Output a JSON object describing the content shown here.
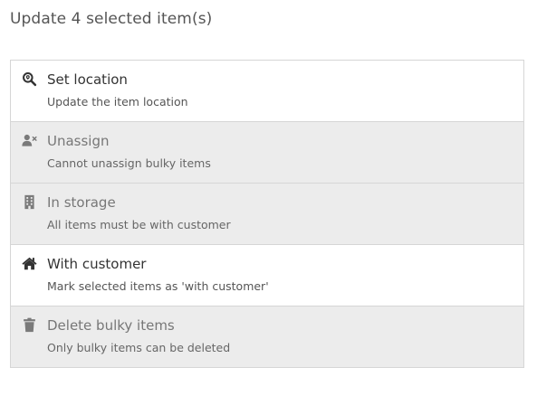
{
  "dialog": {
    "title": "Update 4 selected item(s)"
  },
  "options": [
    {
      "icon": "search-location-icon",
      "label": "Set location",
      "description": "Update the item location",
      "enabled": true
    },
    {
      "icon": "user-remove-icon",
      "label": "Unassign",
      "description": "Cannot unassign bulky items",
      "enabled": false
    },
    {
      "icon": "building-icon",
      "label": "In storage",
      "description": "All items must be with customer",
      "enabled": false
    },
    {
      "icon": "home-icon",
      "label": "With customer",
      "description": "Mark selected items as 'with customer'",
      "enabled": true
    },
    {
      "icon": "trash-icon",
      "label": "Delete bulky items",
      "description": "Only bulky items can be deleted",
      "enabled": false
    }
  ],
  "colors": {
    "enabled_icon": "#333333",
    "disabled_icon": "#7a7a7a",
    "disabled_row_background": "#ececec",
    "border": "#d6d6d6"
  }
}
